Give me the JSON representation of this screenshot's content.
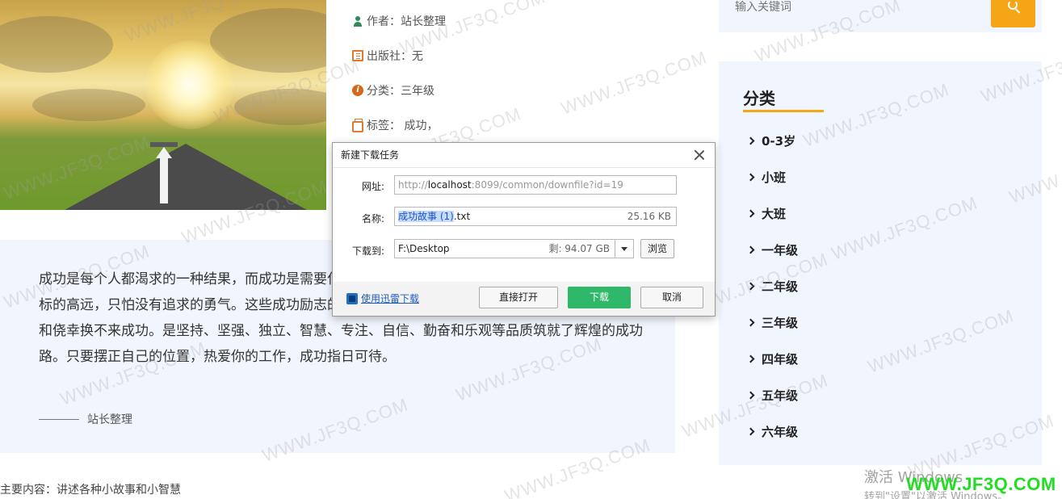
{
  "meta": {
    "author_label": "作者：站长整理",
    "publisher_label": "出版社：无",
    "category_label": "分类：三年级",
    "tags_label": "标签： 成功，"
  },
  "description": {
    "text": "成功是每个人都渴求的一种结果，而成功是需要付出努力的。这些关于成功的小故事告诉我们，不怕目标的高远，只怕没有追求的勇气。这些成功励志的小故事，经典而具有震撼力，小中见大，告诉你投机和侥幸换不来成功。是坚持、坚强、独立、智慧、专注、自信、勤奋和乐观等品质筑就了辉煌的成功路。只要摆正自己的位置，热爱你的工作，成功指日可待。",
    "author": "站长整理"
  },
  "main_content": "主要内容：讲述各种小故事和小智慧",
  "search": {
    "placeholder": "输入关键词"
  },
  "sidebar": {
    "title": "分类",
    "items": [
      "0-3岁",
      "小班",
      "大班",
      "一年级",
      "二年级",
      "三年级",
      "四年级",
      "五年级",
      "六年级"
    ]
  },
  "dialog": {
    "title": "新建下载任务",
    "url_label": "网址:",
    "url_prefix": "http://",
    "url_host": "localhost",
    "url_rest": ":8099/common/downfile?id=19",
    "name_label": "名称:",
    "name_selected": "成功故事 (1)",
    "name_ext": ".txt",
    "file_size": "25.16 KB",
    "saveto_label": "下载到:",
    "saveto_path": "F:\\Desktop",
    "free_space": "剩: 94.07 GB",
    "browse": "浏览",
    "xunlei_link": "使用迅雷下载",
    "open_direct": "直接打开",
    "download": "下载",
    "cancel": "取消"
  },
  "watermark_text": "WWW.JF3Q.COM",
  "windows_activate": {
    "line1": "激活 Windows",
    "line2": "转到\"设置\"以激活 Windows。"
  },
  "brand_mark": "WWW.JF3Q.COM"
}
